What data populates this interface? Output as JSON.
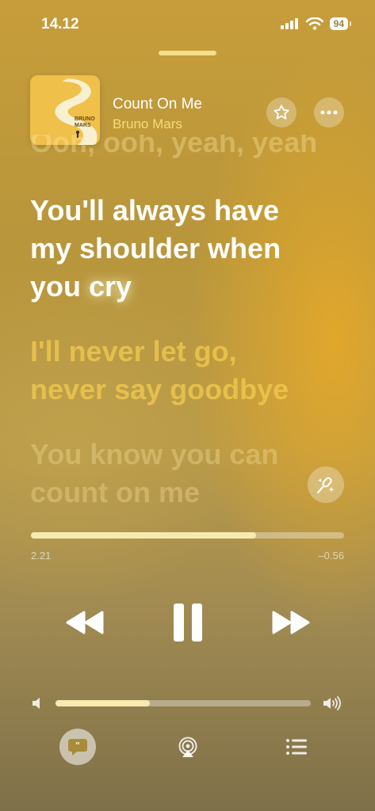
{
  "status_bar": {
    "time": "14.12",
    "battery": "94"
  },
  "now_playing": {
    "title": "Count On Me",
    "artist": "Bruno Mars",
    "album_art_text": "BRUNO MARS"
  },
  "lyrics": {
    "previous": "Ooh, ooh, yeah, yeah",
    "current_line_1": "You'll always have",
    "current_line_2": "my shoulder when",
    "current_line_3_a": "you ",
    "current_line_3_b": "cry",
    "next_1": "I'll never let go,",
    "next_2": "never say goodbye",
    "later_1": "You know you can",
    "later_2": "count on me"
  },
  "playback": {
    "elapsed": "2.21",
    "remaining": "–0.56",
    "progress_fraction": 0.72,
    "volume_fraction": 0.37
  },
  "icons": {
    "favorite": "star-icon",
    "more": "ellipsis-icon",
    "sing": "microphone-sparkle-icon",
    "rewind": "backward-icon",
    "pause": "pause-icon",
    "forward": "forward-icon",
    "volume_low": "speaker-icon",
    "volume_high": "speaker-wave-icon",
    "lyrics": "lyrics-quote-icon",
    "airplay": "airplay-icon",
    "queue": "list-icon"
  },
  "colors": {
    "accent": "#f4dc7a",
    "lyric_current": "#ffffff",
    "lyric_next": "#f0c94f"
  }
}
